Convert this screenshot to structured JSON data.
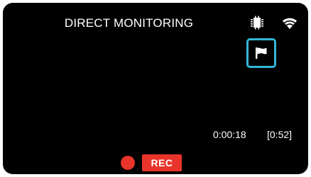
{
  "header": {
    "title": "DIRECT MONITORING",
    "icons": [
      "memory-card-icon",
      "wifi-icon"
    ]
  },
  "controls": {
    "flag_button_icon": "flag-icon",
    "accent_color": "#30b8d8"
  },
  "status": {
    "elapsed_time": "0:00:18",
    "remaining_time": "[0:52]",
    "rec_label": "REC",
    "rec_color": "#e8342a"
  }
}
